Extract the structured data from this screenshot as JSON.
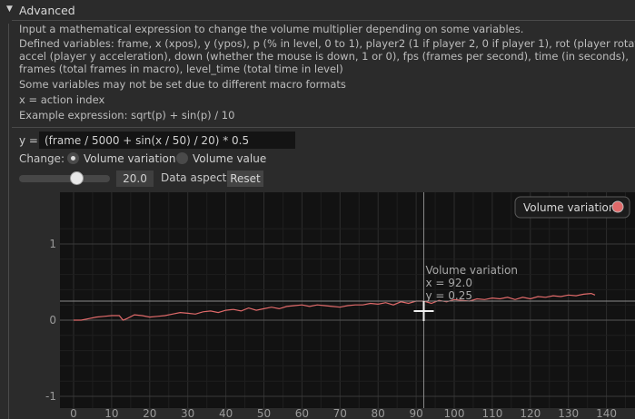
{
  "section": {
    "title": "Advanced"
  },
  "description": [
    "Input a mathematical expression to change the volume multiplier depending on some variables.",
    "Defined variables: frame, x (xpos), y (ypos), p (% in level, 0 to 1), player2 (1 if player 2, 0 if player 1), rot (player rotation),",
    "accel (player y acceleration), down (whether the mouse is down, 1 or 0), fps (frames per second), time (in seconds),",
    "frames (total frames in macro), level_time (total time in level)",
    "Some variables may not be set due to different macro formats",
    "x = action index",
    "Example expression: sqrt(p) + sin(p) / 10"
  ],
  "expression": {
    "label": "y =",
    "value": "(frame / 5000 + sin(x / 50) / 20) * 0.5"
  },
  "change": {
    "label": "Change:",
    "options": [
      "Volume variation",
      "Volume value"
    ],
    "selected": 0
  },
  "aspect": {
    "value": "20.0",
    "label": "Data aspect",
    "reset_label": "Reset"
  },
  "colors": {
    "series": "#e06a6a",
    "background": "#2b2b2b",
    "plot_bg": "#121212"
  },
  "chart_data": {
    "type": "line",
    "legend": "Volume variation",
    "legend_position": "top-right",
    "xlim": [
      -2,
      145
    ],
    "ylim": [
      -1.05,
      1.05
    ],
    "x_ticks": [
      0,
      10,
      20,
      30,
      40,
      50,
      60,
      70,
      80,
      90,
      100,
      110,
      120,
      130,
      140
    ],
    "y_ticks": [
      -1,
      0,
      1
    ],
    "grid": true,
    "hover": {
      "series": "Volume variation",
      "x_label": "x = 92.0",
      "y_label": "y = 0.25",
      "x": 92,
      "y": 0.25
    },
    "series": [
      {
        "name": "Volume variation",
        "x": [
          0,
          2,
          4,
          6,
          8,
          10,
          12,
          13,
          14,
          16,
          18,
          20,
          22,
          24,
          26,
          28,
          30,
          32,
          34,
          36,
          38,
          40,
          42,
          44,
          46,
          48,
          50,
          52,
          54,
          56,
          58,
          60,
          62,
          64,
          66,
          68,
          70,
          72,
          74,
          76,
          78,
          80,
          82,
          84,
          86,
          88,
          90,
          92,
          94,
          96,
          98,
          100,
          102,
          104,
          106,
          108,
          110,
          112,
          114,
          116,
          118,
          120,
          122,
          124,
          126,
          128,
          130,
          132,
          134,
          136,
          137
        ],
        "y": [
          0.0,
          0.0,
          0.02,
          0.04,
          0.05,
          0.06,
          0.06,
          0.0,
          0.02,
          0.07,
          0.06,
          0.04,
          0.05,
          0.06,
          0.08,
          0.1,
          0.09,
          0.08,
          0.11,
          0.12,
          0.1,
          0.13,
          0.14,
          0.12,
          0.16,
          0.13,
          0.15,
          0.17,
          0.15,
          0.18,
          0.19,
          0.2,
          0.18,
          0.2,
          0.19,
          0.18,
          0.17,
          0.19,
          0.2,
          0.2,
          0.22,
          0.21,
          0.23,
          0.2,
          0.24,
          0.22,
          0.25,
          0.25,
          0.22,
          0.26,
          0.24,
          0.27,
          0.26,
          0.25,
          0.28,
          0.27,
          0.29,
          0.28,
          0.3,
          0.27,
          0.3,
          0.28,
          0.31,
          0.3,
          0.32,
          0.31,
          0.33,
          0.32,
          0.34,
          0.35,
          0.33
        ]
      }
    ]
  }
}
